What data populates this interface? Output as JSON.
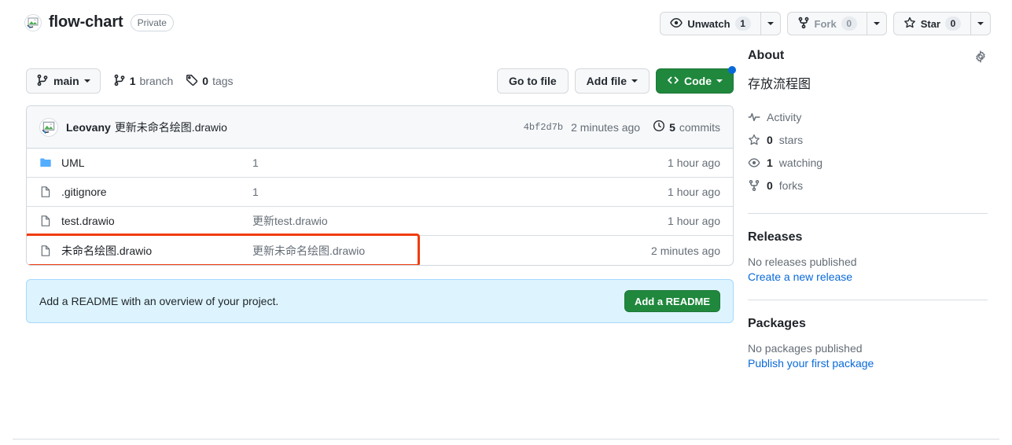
{
  "repo": {
    "name": "flow-chart",
    "visibility": "Private",
    "avatar_icon": "broken-image-avatar"
  },
  "header_actions": {
    "watch": {
      "label": "Unwatch",
      "count": "1",
      "icon": "eye-icon"
    },
    "fork": {
      "label": "Fork",
      "count": "0",
      "icon": "repo-forked-icon"
    },
    "star": {
      "label": "Star",
      "count": "0",
      "icon": "star-icon"
    }
  },
  "toolbar": {
    "branch": {
      "label": "main",
      "icon": "git-branch-icon"
    },
    "branch_count": {
      "value": "1",
      "label": "branch",
      "icon": "git-branch-icon"
    },
    "tag_count": {
      "value": "0",
      "label": "tags",
      "icon": "tag-icon"
    },
    "go_to_file": "Go to file",
    "add_file": "Add file",
    "code": {
      "label": "Code",
      "icon": "code-icon",
      "dot_color": "#0969da"
    }
  },
  "commit_bar": {
    "author": "Leovany",
    "message": "更新未命名绘图.drawio",
    "sha": "4bf2d7b",
    "time": "2 minutes ago",
    "commits_count": "5",
    "commits_label": "commits",
    "history_icon": "history-icon"
  },
  "files": [
    {
      "icon": "folder-icon",
      "type": "folder",
      "name": "UML",
      "message": "1",
      "age": "1 hour ago",
      "highlighted": false
    },
    {
      "icon": "file-icon",
      "type": "file",
      "name": ".gitignore",
      "message": "1",
      "age": "1 hour ago",
      "highlighted": false
    },
    {
      "icon": "file-icon",
      "type": "file",
      "name": "test.drawio",
      "message": "更新test.drawio",
      "age": "1 hour ago",
      "highlighted": false
    },
    {
      "icon": "file-icon",
      "type": "file",
      "name": "未命名绘图.drawio",
      "message": "更新未命名绘图.drawio",
      "age": "2 minutes ago",
      "highlighted": true
    }
  ],
  "annotation": {
    "color": "#f03c0c"
  },
  "readme_banner": {
    "text": "Add a README with an overview of your project.",
    "button": "Add a README"
  },
  "sidebar": {
    "about": {
      "title": "About",
      "gear_icon": "gear-icon",
      "description": "存放流程图",
      "items": [
        {
          "icon": "pulse-icon",
          "value": "",
          "label": "Activity"
        },
        {
          "icon": "star-icon",
          "value": "0",
          "label": "stars"
        },
        {
          "icon": "eye-icon",
          "value": "1",
          "label": "watching"
        },
        {
          "icon": "repo-forked-icon",
          "value": "0",
          "label": "forks"
        }
      ]
    },
    "releases": {
      "title": "Releases",
      "empty_text": "No releases published",
      "link": "Create a new release"
    },
    "packages": {
      "title": "Packages",
      "empty_text": "No packages published",
      "link": "Publish your first package"
    }
  }
}
